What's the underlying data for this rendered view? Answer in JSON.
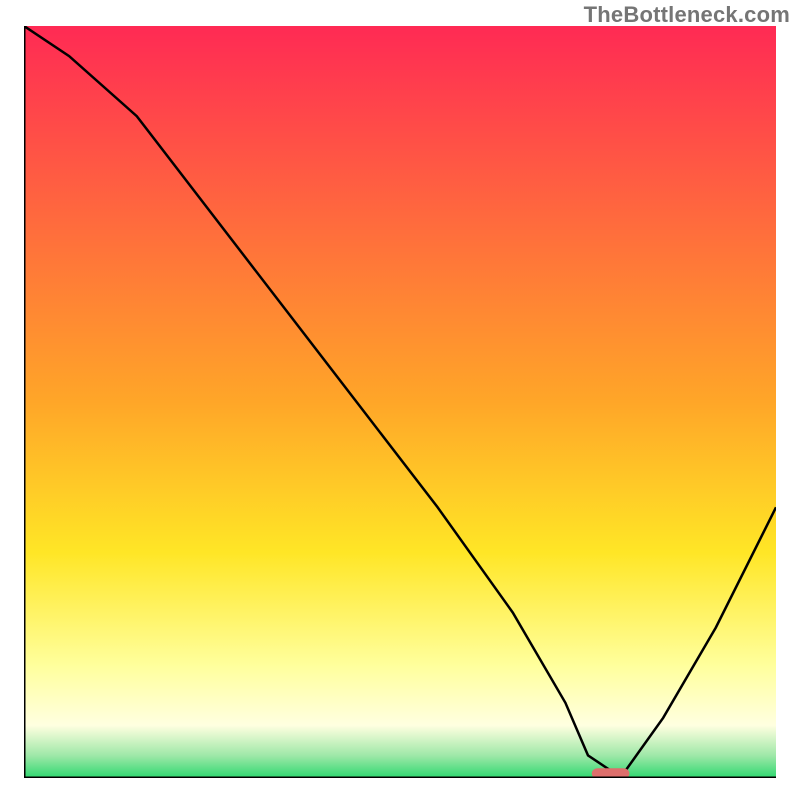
{
  "watermark": "TheBottleneck.com",
  "chart_data": {
    "type": "line",
    "title": "",
    "xlabel": "",
    "ylabel": "",
    "xlim": [
      0,
      100
    ],
    "ylim": [
      0,
      100
    ],
    "grid": false,
    "legend": false,
    "background_gradient": {
      "stops": [
        {
          "offset": 0.0,
          "color": "#ff2a54"
        },
        {
          "offset": 0.5,
          "color": "#ffa628"
        },
        {
          "offset": 0.7,
          "color": "#ffe626"
        },
        {
          "offset": 0.85,
          "color": "#ffff9c"
        },
        {
          "offset": 0.93,
          "color": "#ffffe0"
        },
        {
          "offset": 0.97,
          "color": "#9fe8a8"
        },
        {
          "offset": 1.0,
          "color": "#2fd870"
        }
      ]
    },
    "series": [
      {
        "name": "bottleneck-curve",
        "x": [
          0,
          6,
          15,
          25,
          35,
          45,
          55,
          65,
          72,
          75,
          78,
          80,
          85,
          92,
          100
        ],
        "y": [
          100,
          96,
          88,
          75,
          62,
          49,
          36,
          22,
          10,
          3,
          1,
          1,
          8,
          20,
          36
        ]
      }
    ],
    "marker": {
      "name": "optimal-point",
      "x": 78,
      "y": 0.6,
      "width": 5,
      "height": 1.4,
      "color": "#dd6f6c",
      "shape": "rounded-rect"
    }
  }
}
